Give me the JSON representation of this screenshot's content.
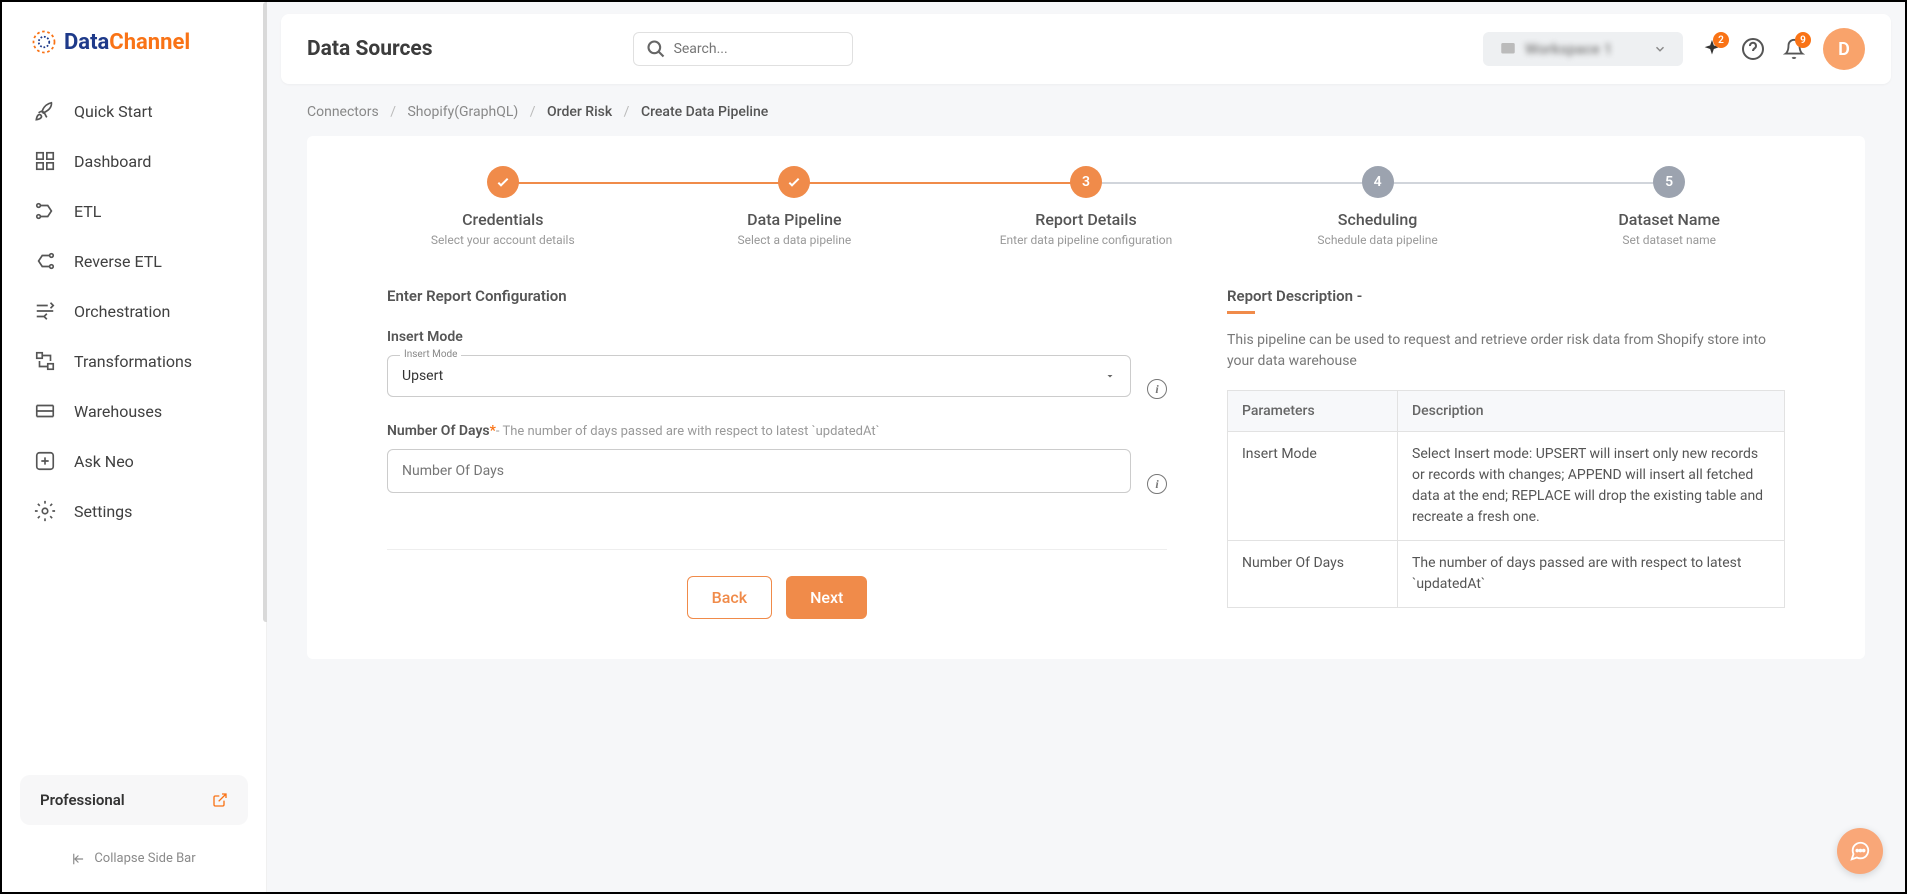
{
  "logo": {
    "part1": "Data",
    "part2": "Channel"
  },
  "sidebar": {
    "items": [
      {
        "label": "Quick Start"
      },
      {
        "label": "Dashboard"
      },
      {
        "label": "ETL"
      },
      {
        "label": "Reverse ETL"
      },
      {
        "label": "Orchestration"
      },
      {
        "label": "Transformations"
      },
      {
        "label": "Warehouses"
      },
      {
        "label": "Ask Neo"
      },
      {
        "label": "Settings"
      }
    ],
    "plan": "Professional",
    "collapse": "Collapse Side Bar"
  },
  "header": {
    "title": "Data Sources",
    "search_placeholder": "Search...",
    "workspace": "Workspace 1",
    "sparkle_badge": "2",
    "bell_badge": "9",
    "avatar": "D"
  },
  "breadcrumb": {
    "a": "Connectors",
    "b": "Shopify(GraphQL)",
    "c": "Order Risk",
    "d": "Create Data Pipeline"
  },
  "stepper": [
    {
      "num": "✓",
      "title": "Credentials",
      "sub": "Select your account details",
      "state": "done"
    },
    {
      "num": "✓",
      "title": "Data Pipeline",
      "sub": "Select a data pipeline",
      "state": "done"
    },
    {
      "num": "3",
      "title": "Report Details",
      "sub": "Enter data pipeline configuration",
      "state": "active"
    },
    {
      "num": "4",
      "title": "Scheduling",
      "sub": "Schedule data pipeline",
      "state": "pending"
    },
    {
      "num": "5",
      "title": "Dataset Name",
      "sub": "Set dataset name",
      "state": "pending"
    }
  ],
  "form": {
    "section_title": "Enter Report Configuration",
    "insert_mode_label": "Insert Mode",
    "insert_mode_float": "Insert Mode",
    "insert_mode_value": "Upsert",
    "days_label": "Number Of Days",
    "days_hint": "- The number of days passed are with respect to latest `updatedAt`",
    "days_placeholder": "Number Of Days",
    "back": "Back",
    "next": "Next"
  },
  "description": {
    "title": "Report Description -",
    "text": "This pipeline can be used to request and retrieve order risk data from Shopify store into your data warehouse",
    "col1": "Parameters",
    "col2": "Description",
    "rows": [
      {
        "p": "Insert Mode",
        "d": "Select Insert mode: UPSERT will insert only new records or records with changes; APPEND will insert all fetched data at the end; REPLACE will drop the existing table and recreate a fresh one."
      },
      {
        "p": "Number Of Days",
        "d": "The number of days passed are with respect to latest `updatedAt`"
      }
    ]
  }
}
